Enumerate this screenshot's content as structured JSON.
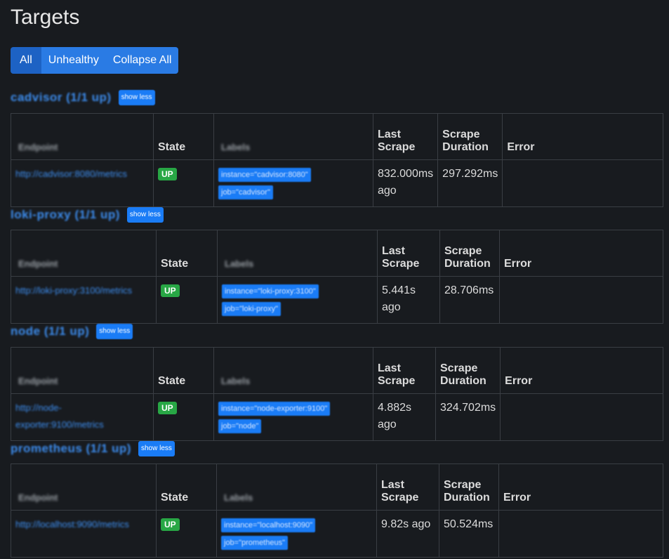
{
  "title": "Targets",
  "filters": {
    "all": "All",
    "unhealthy": "Unhealthy",
    "collapse": "Collapse All"
  },
  "columns": {
    "endpoint": "Endpoint",
    "state": "State",
    "labels": "Labels",
    "last_scrape": "Last Scrape",
    "duration": "Scrape Duration",
    "error": "Error"
  },
  "colors": {
    "accent": "#1a7cf6",
    "up": "#28a745",
    "link": "#3d8ef0",
    "background": "#181b1f"
  },
  "pools": [
    {
      "name": "cadvisor (1/1 up)",
      "toggle": "show less",
      "endpoint": "http://cadvisor:8080/metrics",
      "state": "UP",
      "labels": [
        "instance=\"cadvisor:8080\"",
        "job=\"cadvisor\""
      ],
      "last_scrape": "832.000ms ago",
      "duration": "297.292ms",
      "error": ""
    },
    {
      "name": "loki-proxy (1/1 up)",
      "toggle": "show less",
      "endpoint": "http://loki-proxy:3100/metrics",
      "state": "UP",
      "labels": [
        "instance=\"loki-proxy:3100\"",
        "job=\"loki-proxy\""
      ],
      "last_scrape": "5.441s ago",
      "duration": "28.706ms",
      "error": ""
    },
    {
      "name": "node (1/1 up)",
      "toggle": "show less",
      "endpoint": "http://node-exporter:9100/metrics",
      "state": "UP",
      "labels": [
        "instance=\"node-exporter:9100\"",
        "job=\"node\""
      ],
      "last_scrape": "4.882s ago",
      "duration": "324.702ms",
      "error": ""
    },
    {
      "name": "prometheus (1/1 up)",
      "toggle": "show less",
      "endpoint": "http://localhost:9090/metrics",
      "state": "UP",
      "labels": [
        "instance=\"localhost:9090\"",
        "job=\"prometheus\""
      ],
      "last_scrape": "9.82s ago",
      "duration": "50.524ms",
      "error": ""
    }
  ]
}
